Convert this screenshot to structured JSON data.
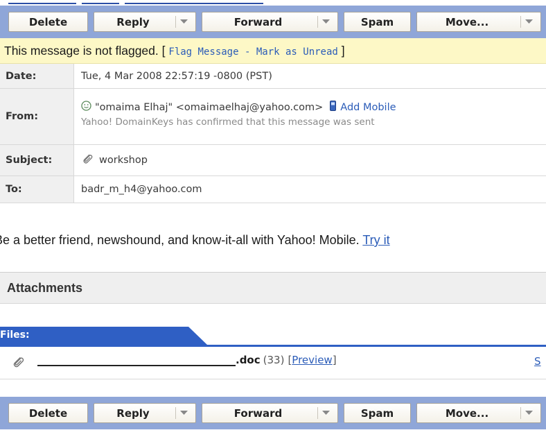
{
  "toolbar": {
    "delete": "Delete",
    "reply": "Reply",
    "forward": "Forward",
    "spam": "Spam",
    "move": "Move..."
  },
  "flag": {
    "status": "This message is not flagged.",
    "open_bracket": "[",
    "flag_link": "Flag Message",
    "sep": " - ",
    "unread_link": "Mark as Unread",
    "close_bracket": "]"
  },
  "headers": {
    "date_label": "Date:",
    "date_value": "Tue, 4 Mar 2008 22:57:19 -0800 (PST)",
    "from_label": "From:",
    "from_value": "\"omaima Elhaj\" <omaimaelhaj@yahoo.com>",
    "add_mobile": "Add Mobile",
    "domainkeys": "Yahoo! DomainKeys has confirmed that this message was sent",
    "subject_label": "Subject:",
    "subject_value": "workshop",
    "to_label": "To:",
    "to_value": "badr_m_h4@yahoo.com"
  },
  "promo": {
    "text": "Be a better friend, newshound, and know-it-all with Yahoo! Mobile.",
    "link": "Try it"
  },
  "attachments": {
    "heading": "Attachments",
    "files_tab": "Files:",
    "file_ext": ".doc",
    "file_size": "(33)",
    "preview_open": "[",
    "preview": "Preview",
    "preview_close": "]",
    "save_link": "S"
  },
  "colors": {
    "toolbar_bg": "#8fa6d8",
    "flag_bg": "#fdf8c6",
    "link": "#2b5cb8",
    "files_tab": "#2f5fc4"
  }
}
